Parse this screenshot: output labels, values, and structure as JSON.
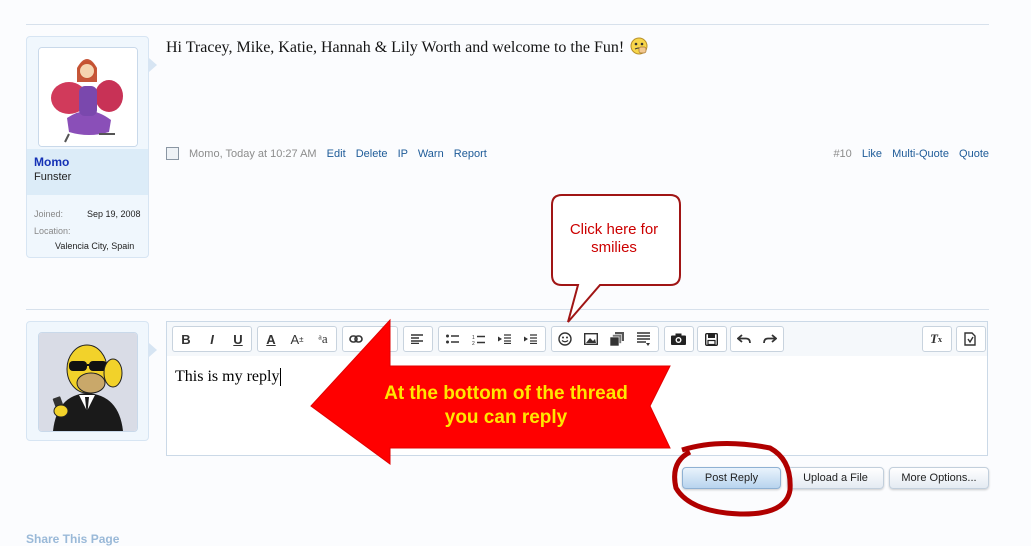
{
  "post": {
    "username": "Momo",
    "user_title": "Funster",
    "joined_label": "Joined:",
    "joined_value": "Sep 19, 2008",
    "location_label": "Location:",
    "location_value": "Valencia City, Spain",
    "message": "Hi Tracey, Mike, Katie, Hannah & Lily Worth and welcome to the Fun!",
    "author": "Momo",
    "timestamp": "Today at 10:27 AM",
    "actions": [
      "Edit",
      "Delete",
      "IP",
      "Warn",
      "Report"
    ],
    "post_number": "#10",
    "right_actions": [
      "Like",
      "Multi-Quote",
      "Quote"
    ]
  },
  "editor": {
    "content": "This is my reply",
    "toolbar_icons": [
      "bold-icon",
      "italic-icon",
      "underline-icon",
      "font-color-icon",
      "font-size-icon",
      "font-family-icon",
      "link-icon",
      "unlink-icon",
      "align-icon",
      "bullet-list-icon",
      "number-list-icon",
      "outdent-icon",
      "indent-icon",
      "smilies-icon",
      "image-icon",
      "media-icon",
      "insert-more-icon",
      "camera-icon",
      "save-draft-icon",
      "undo-icon",
      "redo-icon",
      "remove-format-icon",
      "toggle-bbcode-icon"
    ]
  },
  "buttons": {
    "post_reply": "Post Reply",
    "upload": "Upload a File",
    "more_options": "More Options..."
  },
  "share_label": "Share This Page",
  "annotations": {
    "tooltip": "Click here for smilies",
    "arrow": "At the bottom of the thread you can reply"
  },
  "colors": {
    "annotation_red": "#ff0000",
    "annotation_text_yellow": "#ffe600",
    "link_blue": "#1e5b98"
  }
}
